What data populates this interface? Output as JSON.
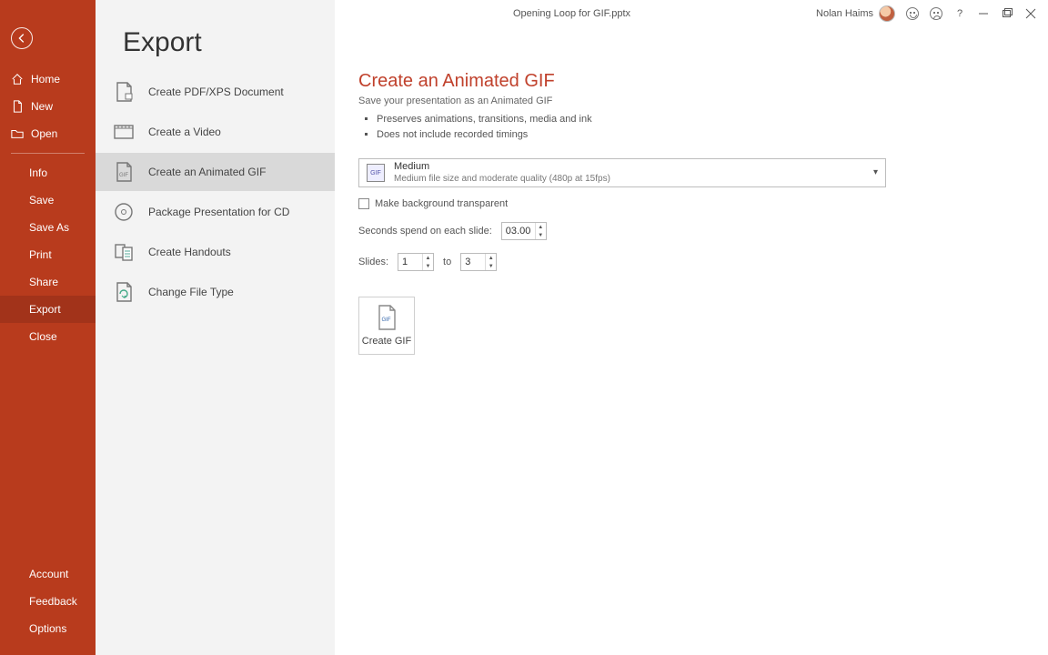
{
  "titlebar": {
    "document_title": "Opening Loop for GIF.pptx",
    "user_name": "Nolan Haims"
  },
  "sidebar": {
    "top": [
      {
        "label": "Home",
        "name": "sidebar-item-home",
        "icon": "home"
      },
      {
        "label": "New",
        "name": "sidebar-item-new",
        "icon": "new"
      },
      {
        "label": "Open",
        "name": "sidebar-item-open",
        "icon": "open"
      }
    ],
    "middle": [
      {
        "label": "Info",
        "name": "sidebar-item-info"
      },
      {
        "label": "Save",
        "name": "sidebar-item-save"
      },
      {
        "label": "Save As",
        "name": "sidebar-item-saveas"
      },
      {
        "label": "Print",
        "name": "sidebar-item-print"
      },
      {
        "label": "Share",
        "name": "sidebar-item-share"
      },
      {
        "label": "Export",
        "name": "sidebar-item-export",
        "selected": true
      },
      {
        "label": "Close",
        "name": "sidebar-item-close"
      }
    ],
    "bottom": [
      {
        "label": "Account",
        "name": "sidebar-item-account"
      },
      {
        "label": "Feedback",
        "name": "sidebar-item-feedback"
      },
      {
        "label": "Options",
        "name": "sidebar-item-options"
      }
    ]
  },
  "export": {
    "page_title": "Export",
    "options": [
      {
        "label": "Create PDF/XPS Document",
        "name": "export-pdfxps",
        "icon": "pdf"
      },
      {
        "label": "Create a Video",
        "name": "export-video",
        "icon": "video"
      },
      {
        "label": "Create an Animated GIF",
        "name": "export-anim-gif",
        "icon": "gif",
        "selected": true
      },
      {
        "label": "Package Presentation for CD",
        "name": "export-package",
        "icon": "cd"
      },
      {
        "label": "Create Handouts",
        "name": "export-handouts",
        "icon": "handouts"
      },
      {
        "label": "Change File Type",
        "name": "export-filetype",
        "icon": "filetype"
      }
    ]
  },
  "content": {
    "heading": "Create an Animated GIF",
    "subtitle": "Save your presentation as an Animated GIF",
    "bullets": [
      "Preserves animations, transitions, media and ink",
      "Does not include recorded timings"
    ],
    "quality": {
      "title": "Medium",
      "desc": "Medium file size and moderate quality (480p at 15fps)"
    },
    "transparent_label": "Make background transparent",
    "seconds_label": "Seconds spend on each slide:",
    "seconds_value": "03.00",
    "slides_label": "Slides:",
    "slides_from": "1",
    "slides_to_label": "to",
    "slides_to": "3",
    "create_button": "Create GIF"
  }
}
